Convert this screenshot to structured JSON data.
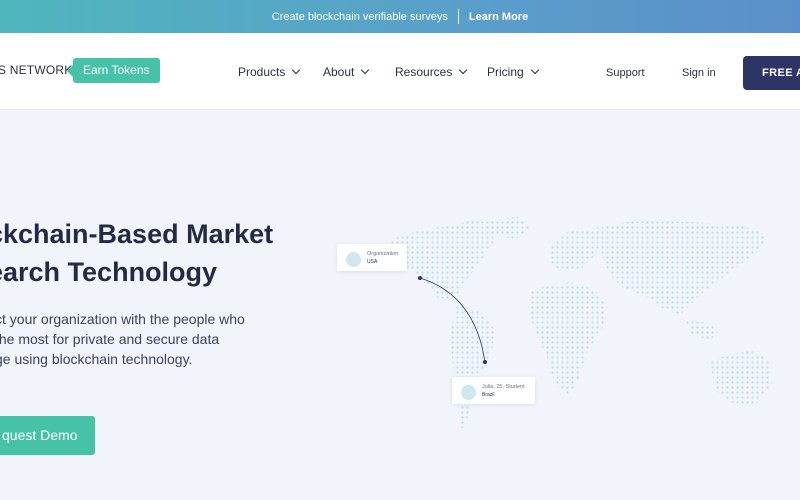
{
  "announcement": {
    "text": "Create blockchain verifiable surveys",
    "link": "Learn More"
  },
  "nav": {
    "brand": "S NETWORK",
    "earn_tokens": "Earn Tokens",
    "menu": [
      "Products",
      "About",
      "Resources",
      "Pricing"
    ],
    "support": "Support",
    "signin": "Sign in",
    "cta": "FREE AC"
  },
  "hero": {
    "title_line1": "ckchain-Based Market",
    "title_line2": "earch Technology",
    "desc_line1": "ct your organization with the people who",
    "desc_line2": " the most for private and secure data",
    "desc_line3": "ge using blockchain technology.",
    "button": "quest Demo"
  },
  "map": {
    "card1": {
      "title": "Organization",
      "sub": "USA"
    },
    "card2": {
      "title": "Julia, 25, Student",
      "sub": "Brazil"
    }
  },
  "colors": {
    "accent": "#45c2a8",
    "navy": "#2c3566",
    "map_dot": "#b7dfe3"
  }
}
